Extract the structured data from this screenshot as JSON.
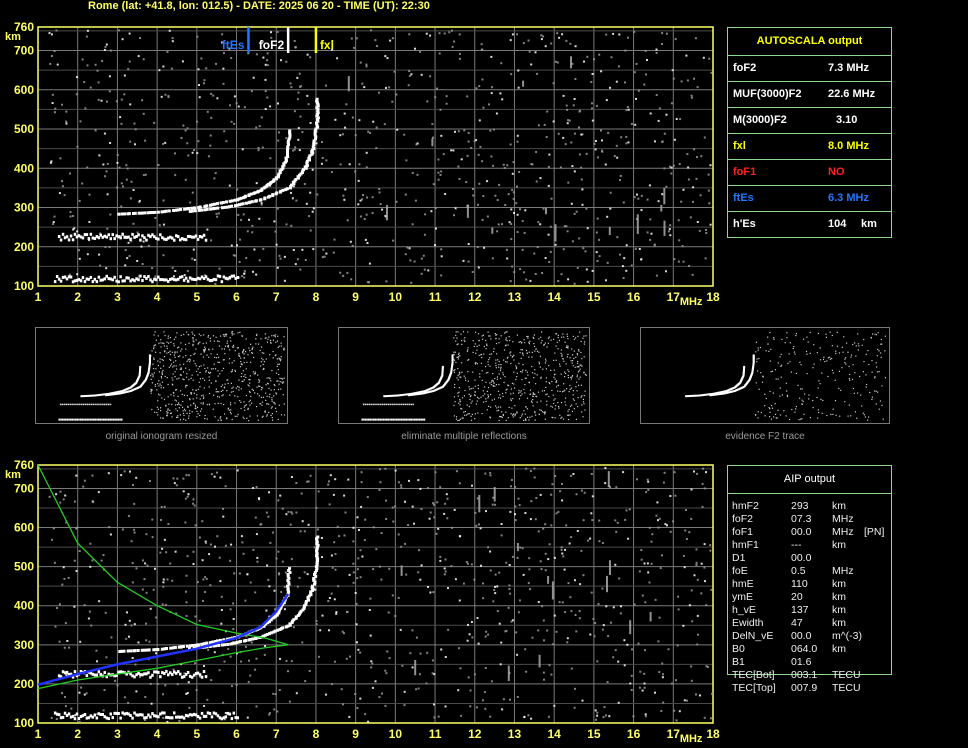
{
  "header": {
    "title": "Rome (lat: +41.8, lon: 012.5) - DATE: 2025 06 20 - TIME (UT): 22:30"
  },
  "colors": {
    "axis": "#ffff66",
    "grid": "#7a7a7a",
    "ftEs": "#2277ff",
    "foF2": "#ffffff",
    "fxl": "#ffff00",
    "foF1": "#ff2020",
    "border": "#8fd98f",
    "aip_profile_blue": "#2233ff",
    "aip_profile_green": "#22cc22"
  },
  "chart_data": [
    {
      "type": "scatter",
      "name": "main ionogram",
      "xlabel": "MHz",
      "ylabel": "km",
      "xlim": [
        1,
        18
      ],
      "ylim": [
        100,
        760
      ],
      "xticks": [
        "1",
        "2",
        "3",
        "4",
        "5",
        "6",
        "7",
        "8",
        "9",
        "10",
        "11",
        "12",
        "13",
        "14",
        "15",
        "16",
        "17",
        "18"
      ],
      "yticks": [
        "100",
        "200",
        "300",
        "400",
        "500",
        "600",
        "700",
        "760"
      ],
      "grid": true,
      "markers": [
        {
          "label": "ftEs",
          "x": 6.3,
          "color": "#2277ff"
        },
        {
          "label": "foF2",
          "x": 7.3,
          "color": "#ffffff"
        },
        {
          "label": "fxl",
          "x": 8.0,
          "color": "#ffff00"
        }
      ],
      "traces": {
        "es_trace": {
          "x": [
            1.4,
            6.0
          ],
          "y": 117
        },
        "es_multiple": {
          "x": [
            1.5,
            5.2
          ],
          "y": 223
        },
        "o_trace": [
          [
            3.0,
            283
          ],
          [
            4.0,
            288
          ],
          [
            5.0,
            300
          ],
          [
            6.0,
            320
          ],
          [
            6.6,
            345
          ],
          [
            7.0,
            378
          ],
          [
            7.25,
            430
          ],
          [
            7.3,
            500
          ]
        ],
        "x_trace": [
          [
            4.8,
            290
          ],
          [
            5.8,
            302
          ],
          [
            6.6,
            320
          ],
          [
            7.3,
            350
          ],
          [
            7.7,
            400
          ],
          [
            7.9,
            450
          ],
          [
            8.0,
            520
          ],
          [
            8.0,
            580
          ]
        ]
      }
    },
    {
      "type": "scatter",
      "name": "thumbnails",
      "captions": [
        "original ionogram resized",
        "eliminate multiple reflections",
        "evidence F2 trace"
      ]
    },
    {
      "type": "line",
      "name": "AIP profile",
      "xlabel": "MHz",
      "ylabel": "km",
      "xlim": [
        1,
        18
      ],
      "ylim": [
        100,
        760
      ],
      "xticks": [
        "1",
        "2",
        "3",
        "4",
        "5",
        "6",
        "7",
        "8",
        "9",
        "10",
        "11",
        "12",
        "13",
        "14",
        "15",
        "16",
        "17",
        "18"
      ],
      "yticks": [
        "100",
        "200",
        "300",
        "400",
        "500",
        "600",
        "700",
        "760"
      ],
      "grid": true,
      "blue_profile": [
        [
          1.0,
          198
        ],
        [
          2.0,
          225
        ],
        [
          3.0,
          250
        ],
        [
          4.0,
          270
        ],
        [
          5.0,
          290
        ],
        [
          6.0,
          318
        ],
        [
          6.6,
          345
        ],
        [
          7.0,
          385
        ],
        [
          7.3,
          430
        ]
      ],
      "green_profile": [
        [
          1.0,
          188
        ],
        [
          2.0,
          210
        ],
        [
          3.0,
          225
        ],
        [
          4.0,
          240
        ],
        [
          5.0,
          260
        ],
        [
          6.0,
          280
        ],
        [
          6.7,
          292
        ],
        [
          7.3,
          300
        ],
        [
          6.7,
          318
        ],
        [
          6.0,
          330
        ],
        [
          5.0,
          352
        ],
        [
          4.0,
          400
        ],
        [
          3.0,
          460
        ],
        [
          2.0,
          560
        ],
        [
          1.0,
          760
        ]
      ]
    }
  ],
  "autoscala": {
    "title": "AUTOSCALA output",
    "rows": [
      {
        "label": "foF2",
        "value": "7.3 MHz",
        "unit": "",
        "color": "#ffffff"
      },
      {
        "label": "MUF(3000)F2",
        "value": "22.6 MHz",
        "unit": "",
        "color": "#ffffff"
      },
      {
        "label": "M(3000)F2",
        "value": "3.10",
        "unit": "",
        "color": "#ffffff"
      },
      {
        "label": "fxl",
        "value": "8.0 MHz",
        "unit": "",
        "color": "#ffff00"
      },
      {
        "label": "foF1",
        "value": "NO",
        "unit": "",
        "color": "#ff2020"
      },
      {
        "label": "ftEs",
        "value": "6.3 MHz",
        "unit": "",
        "color": "#2277ff"
      },
      {
        "label": "h'Es",
        "value": "104",
        "unit": "km",
        "color": "#ffffff"
      }
    ]
  },
  "aip": {
    "title": "AIP output",
    "rows": [
      {
        "name": "hmF2",
        "value": "293",
        "unit": "km",
        "extra": ""
      },
      {
        "name": "foF2",
        "value": "07.3",
        "unit": "MHz",
        "extra": ""
      },
      {
        "name": "foF1",
        "value": "00.0",
        "unit": "MHz",
        "extra": "[PN]"
      },
      {
        "name": "hmF1",
        "value": "---",
        "unit": "km",
        "extra": ""
      },
      {
        "name": "D1",
        "value": "00.0",
        "unit": "",
        "extra": ""
      },
      {
        "name": "foE",
        "value": "0.5",
        "unit": "MHz",
        "extra": ""
      },
      {
        "name": "hmE",
        "value": "110",
        "unit": "km",
        "extra": ""
      },
      {
        "name": "ymE",
        "value": "20",
        "unit": "km",
        "extra": ""
      },
      {
        "name": "h_vE",
        "value": "137",
        "unit": "km",
        "extra": ""
      },
      {
        "name": "Ewidth",
        "value": "47",
        "unit": "km",
        "extra": ""
      },
      {
        "name": "DelN_vE",
        "value": "00.0",
        "unit": "m^(-3)",
        "extra": ""
      },
      {
        "name": "B0",
        "value": "064.0",
        "unit": "km",
        "extra": ""
      },
      {
        "name": "B1",
        "value": "01.6",
        "unit": "",
        "extra": ""
      },
      {
        "name": "TEC[Bot]",
        "value": "003.1",
        "unit": "TECU",
        "extra": ""
      },
      {
        "name": "TEC[Top]",
        "value": "007.9",
        "unit": "TECU",
        "extra": ""
      }
    ]
  }
}
